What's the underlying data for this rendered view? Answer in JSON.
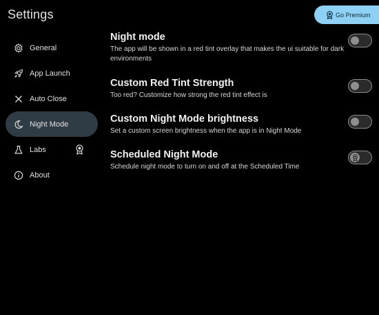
{
  "header": {
    "title": "Settings",
    "premium_label": "Go Premium"
  },
  "sidebar": {
    "items": [
      {
        "label": "General"
      },
      {
        "label": "App Launch"
      },
      {
        "label": "Auto Close"
      },
      {
        "label": "Night Mode"
      },
      {
        "label": "Labs"
      },
      {
        "label": "About"
      }
    ],
    "active": "Night Mode"
  },
  "settings": [
    {
      "title": "Night mode",
      "description": "The app will be shown in a red tint overlay that makes the ui suitable for dark environments",
      "enabled": false
    },
    {
      "title": "Custom Red Tint Strength",
      "description": "Too red? Customize how strong the red tint effect is",
      "enabled": false
    },
    {
      "title": "Custom Night Mode brightness",
      "description": "Set a custom screen brightness when the app is in Night Mode",
      "enabled": false
    },
    {
      "title": "Scheduled Night Mode",
      "description": "Schedule night mode to turn on and off at the Scheduled Time",
      "enabled": false,
      "premium_locked": true
    }
  ],
  "colors": {
    "background": "#000000",
    "premium_button": "#8fd1f5",
    "active_nav": "#2f3c45"
  }
}
